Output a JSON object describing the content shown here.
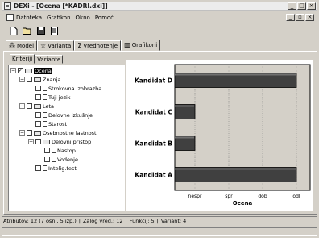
{
  "window": {
    "title": "DEXi - [Ocena [*KADRI.dxi]]",
    "controls": {
      "minimize": "_",
      "maximize": "□",
      "close": "×"
    }
  },
  "menu": {
    "items": [
      "Datoteka",
      "Grafikon",
      "Okno",
      "Pomoč"
    ],
    "child_controls": {
      "minimize": "_",
      "restore": "▫",
      "close": "×"
    }
  },
  "toolbar": {
    "icons": [
      "new-file-icon",
      "open-folder-icon",
      "save-icon",
      "page-icon"
    ]
  },
  "main_tabs": [
    {
      "label": "Model",
      "icon": "model-icon"
    },
    {
      "label": "Varianta",
      "icon": "star-icon"
    },
    {
      "label": "Vrednotenje",
      "icon": "sigma-icon"
    },
    {
      "label": "Grafikoni",
      "icon": "chart-icon",
      "active": true
    }
  ],
  "sub_tabs": [
    {
      "label": "Kriteriji",
      "active": true
    },
    {
      "label": "Variante"
    }
  ],
  "tree": {
    "nodes": [
      {
        "label": "Ocena",
        "level": 0,
        "expander": "−",
        "checked": true,
        "selected": true
      },
      {
        "label": "Znanja",
        "level": 1,
        "expander": "−",
        "checked": false
      },
      {
        "label": "Strokovna izobrazba",
        "level": 2,
        "checked": false
      },
      {
        "label": "Tuji jezik",
        "level": 2,
        "checked": false
      },
      {
        "label": "Leta",
        "level": 1,
        "expander": "−",
        "checked": false
      },
      {
        "label": "Delovne izkušnje",
        "level": 2,
        "checked": false
      },
      {
        "label": "Starost",
        "level": 2,
        "checked": false
      },
      {
        "label": "Osebnostne lastnosti",
        "level": 1,
        "expander": "−",
        "checked": false
      },
      {
        "label": "Delovni pristop",
        "level": 2,
        "expander": "−",
        "checked": false
      },
      {
        "label": "Nastop",
        "level": 3,
        "checked": false
      },
      {
        "label": "Vodenje",
        "level": 3,
        "checked": false
      },
      {
        "label": "Intelig.test",
        "level": 2,
        "checked": false
      }
    ]
  },
  "chart_data": {
    "type": "bar",
    "orientation": "horizontal",
    "categories": [
      "Kandidat D",
      "Kandidat C",
      "Kandidat B",
      "Kandidat A"
    ],
    "values": [
      "odl",
      "nespr",
      "nespr",
      "odl"
    ],
    "scale": [
      "nespr",
      "spr",
      "dob",
      "odl"
    ],
    "xlabel": "Ocena",
    "grid": true,
    "bar_color": "#404040",
    "plot_background": "#d4d0c8"
  },
  "status": {
    "atributov": "Atributov: 12 (7 osn., 5 izp.)",
    "zalog": "Zalog vred.: 12",
    "funkcij": "Funkcij: 5",
    "variant": "Variant: 4"
  }
}
